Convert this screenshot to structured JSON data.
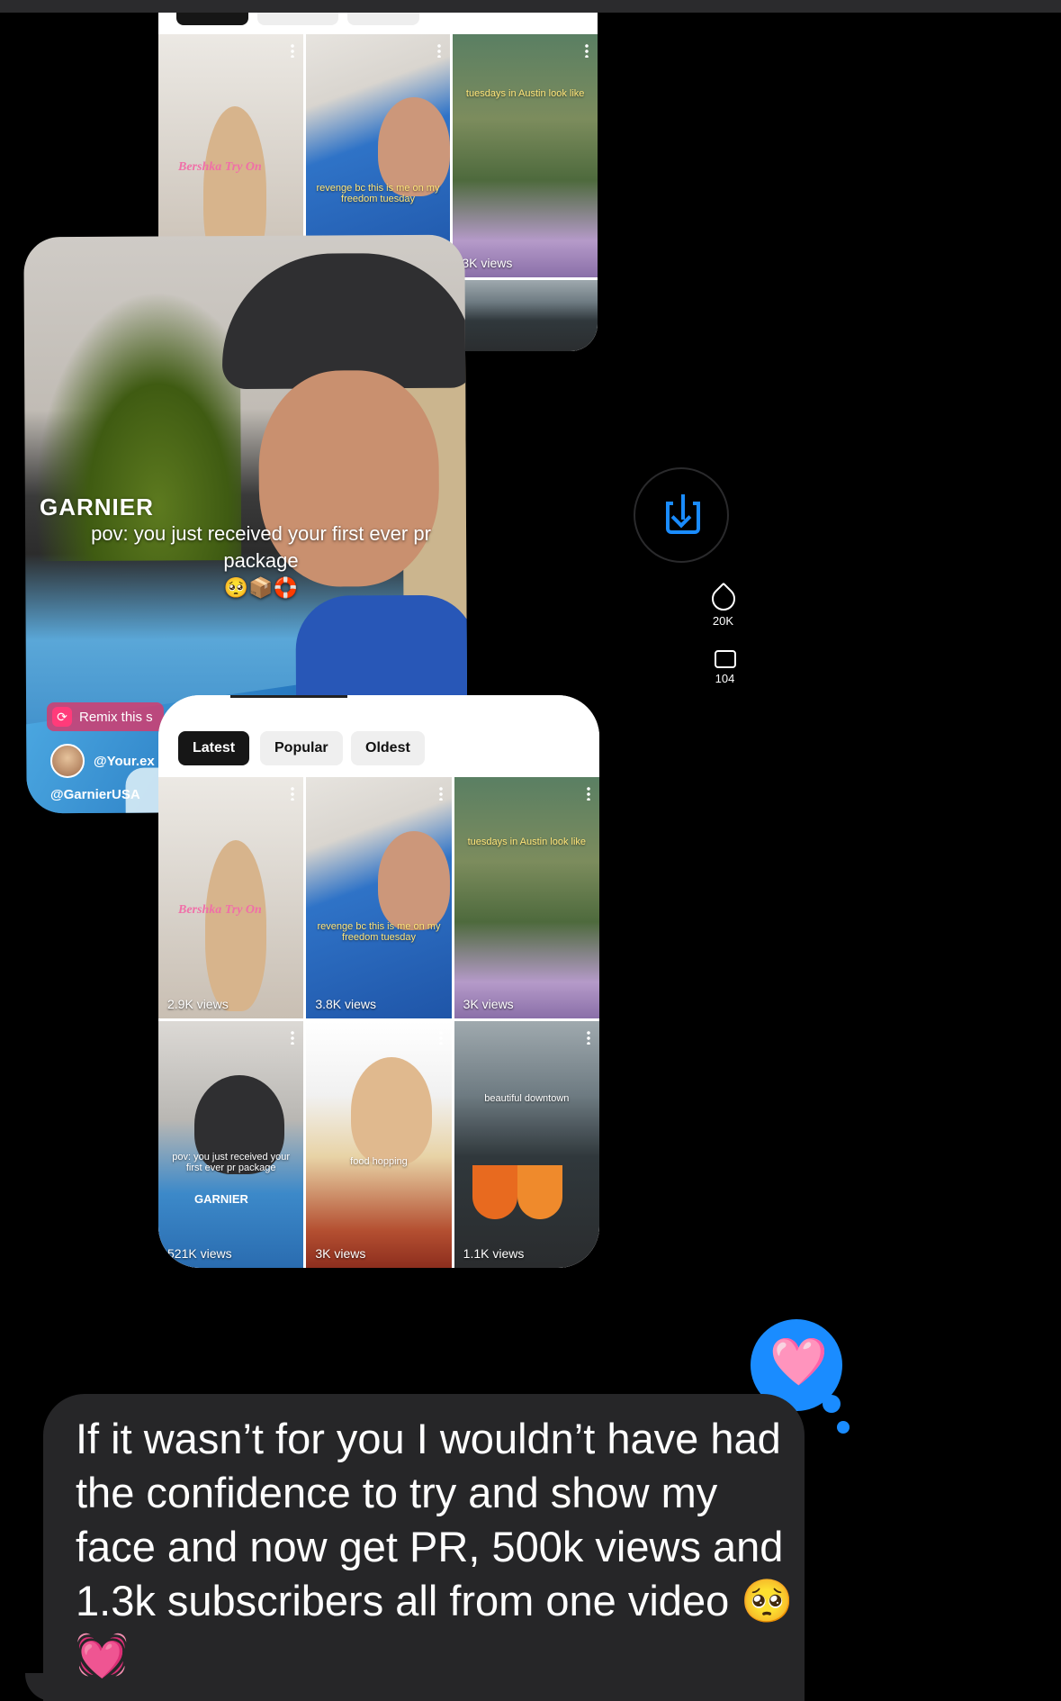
{
  "top_card": {
    "views": [
      "3K views"
    ],
    "captions": {
      "tile1": "Bershka Try On",
      "tile2": "revenge bc this is me on my freedom tuesday",
      "tile3": "tuesdays in Austin look like"
    }
  },
  "video": {
    "brand_logo": "GARNIER",
    "caption": "pov: you just received your first ever pr package",
    "emojis": "🥺📦🛟",
    "likes": "20K",
    "comments": "104",
    "remix_label": "Remix this s",
    "user_handle": "@Your.ex",
    "brand_handle": "@GarnierUSA",
    "icons": [
      "heart-outline-icon",
      "comment-icon",
      "remix-icon"
    ]
  },
  "profile_grid": {
    "tabs": [
      "Latest",
      "Popular",
      "Oldest"
    ],
    "active_tab": "Latest",
    "tiles": [
      {
        "views": "2.9K views",
        "caption": "Bershka Try On"
      },
      {
        "views": "3.8K views",
        "caption": "revenge bc this is me on my freedom tuesday"
      },
      {
        "views": "3K views",
        "caption": "tuesdays in Austin look like"
      },
      {
        "views": "521K views",
        "caption": "pov: you just received your first ever pr package",
        "brand": "GARNIER"
      },
      {
        "views": "3K views",
        "caption": "food hopping"
      },
      {
        "views": "1.1K views",
        "caption": "beautiful downtown"
      }
    ]
  },
  "share_button": {
    "icon": "download-share-icon"
  },
  "tapback": {
    "icon": "heart-tapback-icon",
    "glyph": "🩷",
    "color": "#1a8cff"
  },
  "message": {
    "text": "If it wasn’t for you I wouldn’t have had the confidence to try and show my face and now get PR, 500k views and 1.3k subscribers all from one video 🥺💓"
  }
}
